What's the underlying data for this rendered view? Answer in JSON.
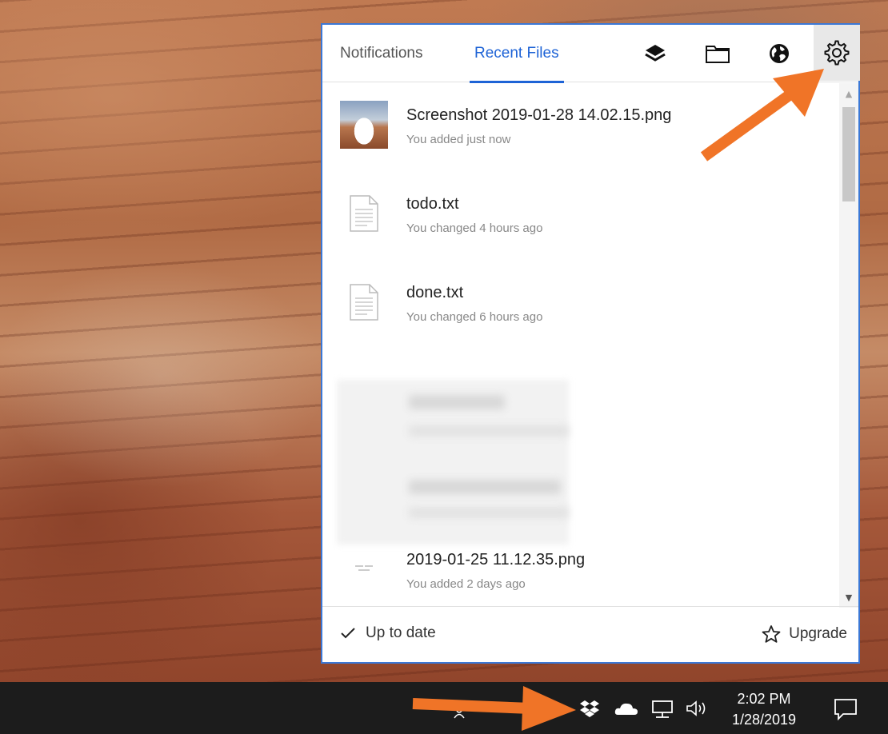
{
  "tabs": {
    "notifications": "Notifications",
    "recent_files": "Recent Files"
  },
  "toolbar_icons": [
    "layers-icon",
    "folder-icon",
    "globe-icon",
    "gear-icon"
  ],
  "files": [
    {
      "name": "Screenshot 2019-01-28 14.02.15.png",
      "meta": "You added just now",
      "icon": "image-thumbnail"
    },
    {
      "name": "todo.txt",
      "meta": "You changed 4 hours ago",
      "icon": "text-file-icon"
    },
    {
      "name": "done.txt",
      "meta": "You changed 6 hours ago",
      "icon": "text-file-icon"
    },
    {
      "name": "2019-01-25 11.12.35.png",
      "meta": "You added 2 days ago",
      "icon": "image-thumbnail"
    }
  ],
  "footer": {
    "status": "Up to date",
    "upgrade": "Upgrade"
  },
  "taskbar": {
    "time": "2:02 PM",
    "date": "1/28/2019"
  },
  "colors": {
    "accent": "#1e63d6",
    "panel_border": "#3b78d6",
    "annotation_arrow": "#f07427",
    "taskbar": "#1c1c1c"
  }
}
